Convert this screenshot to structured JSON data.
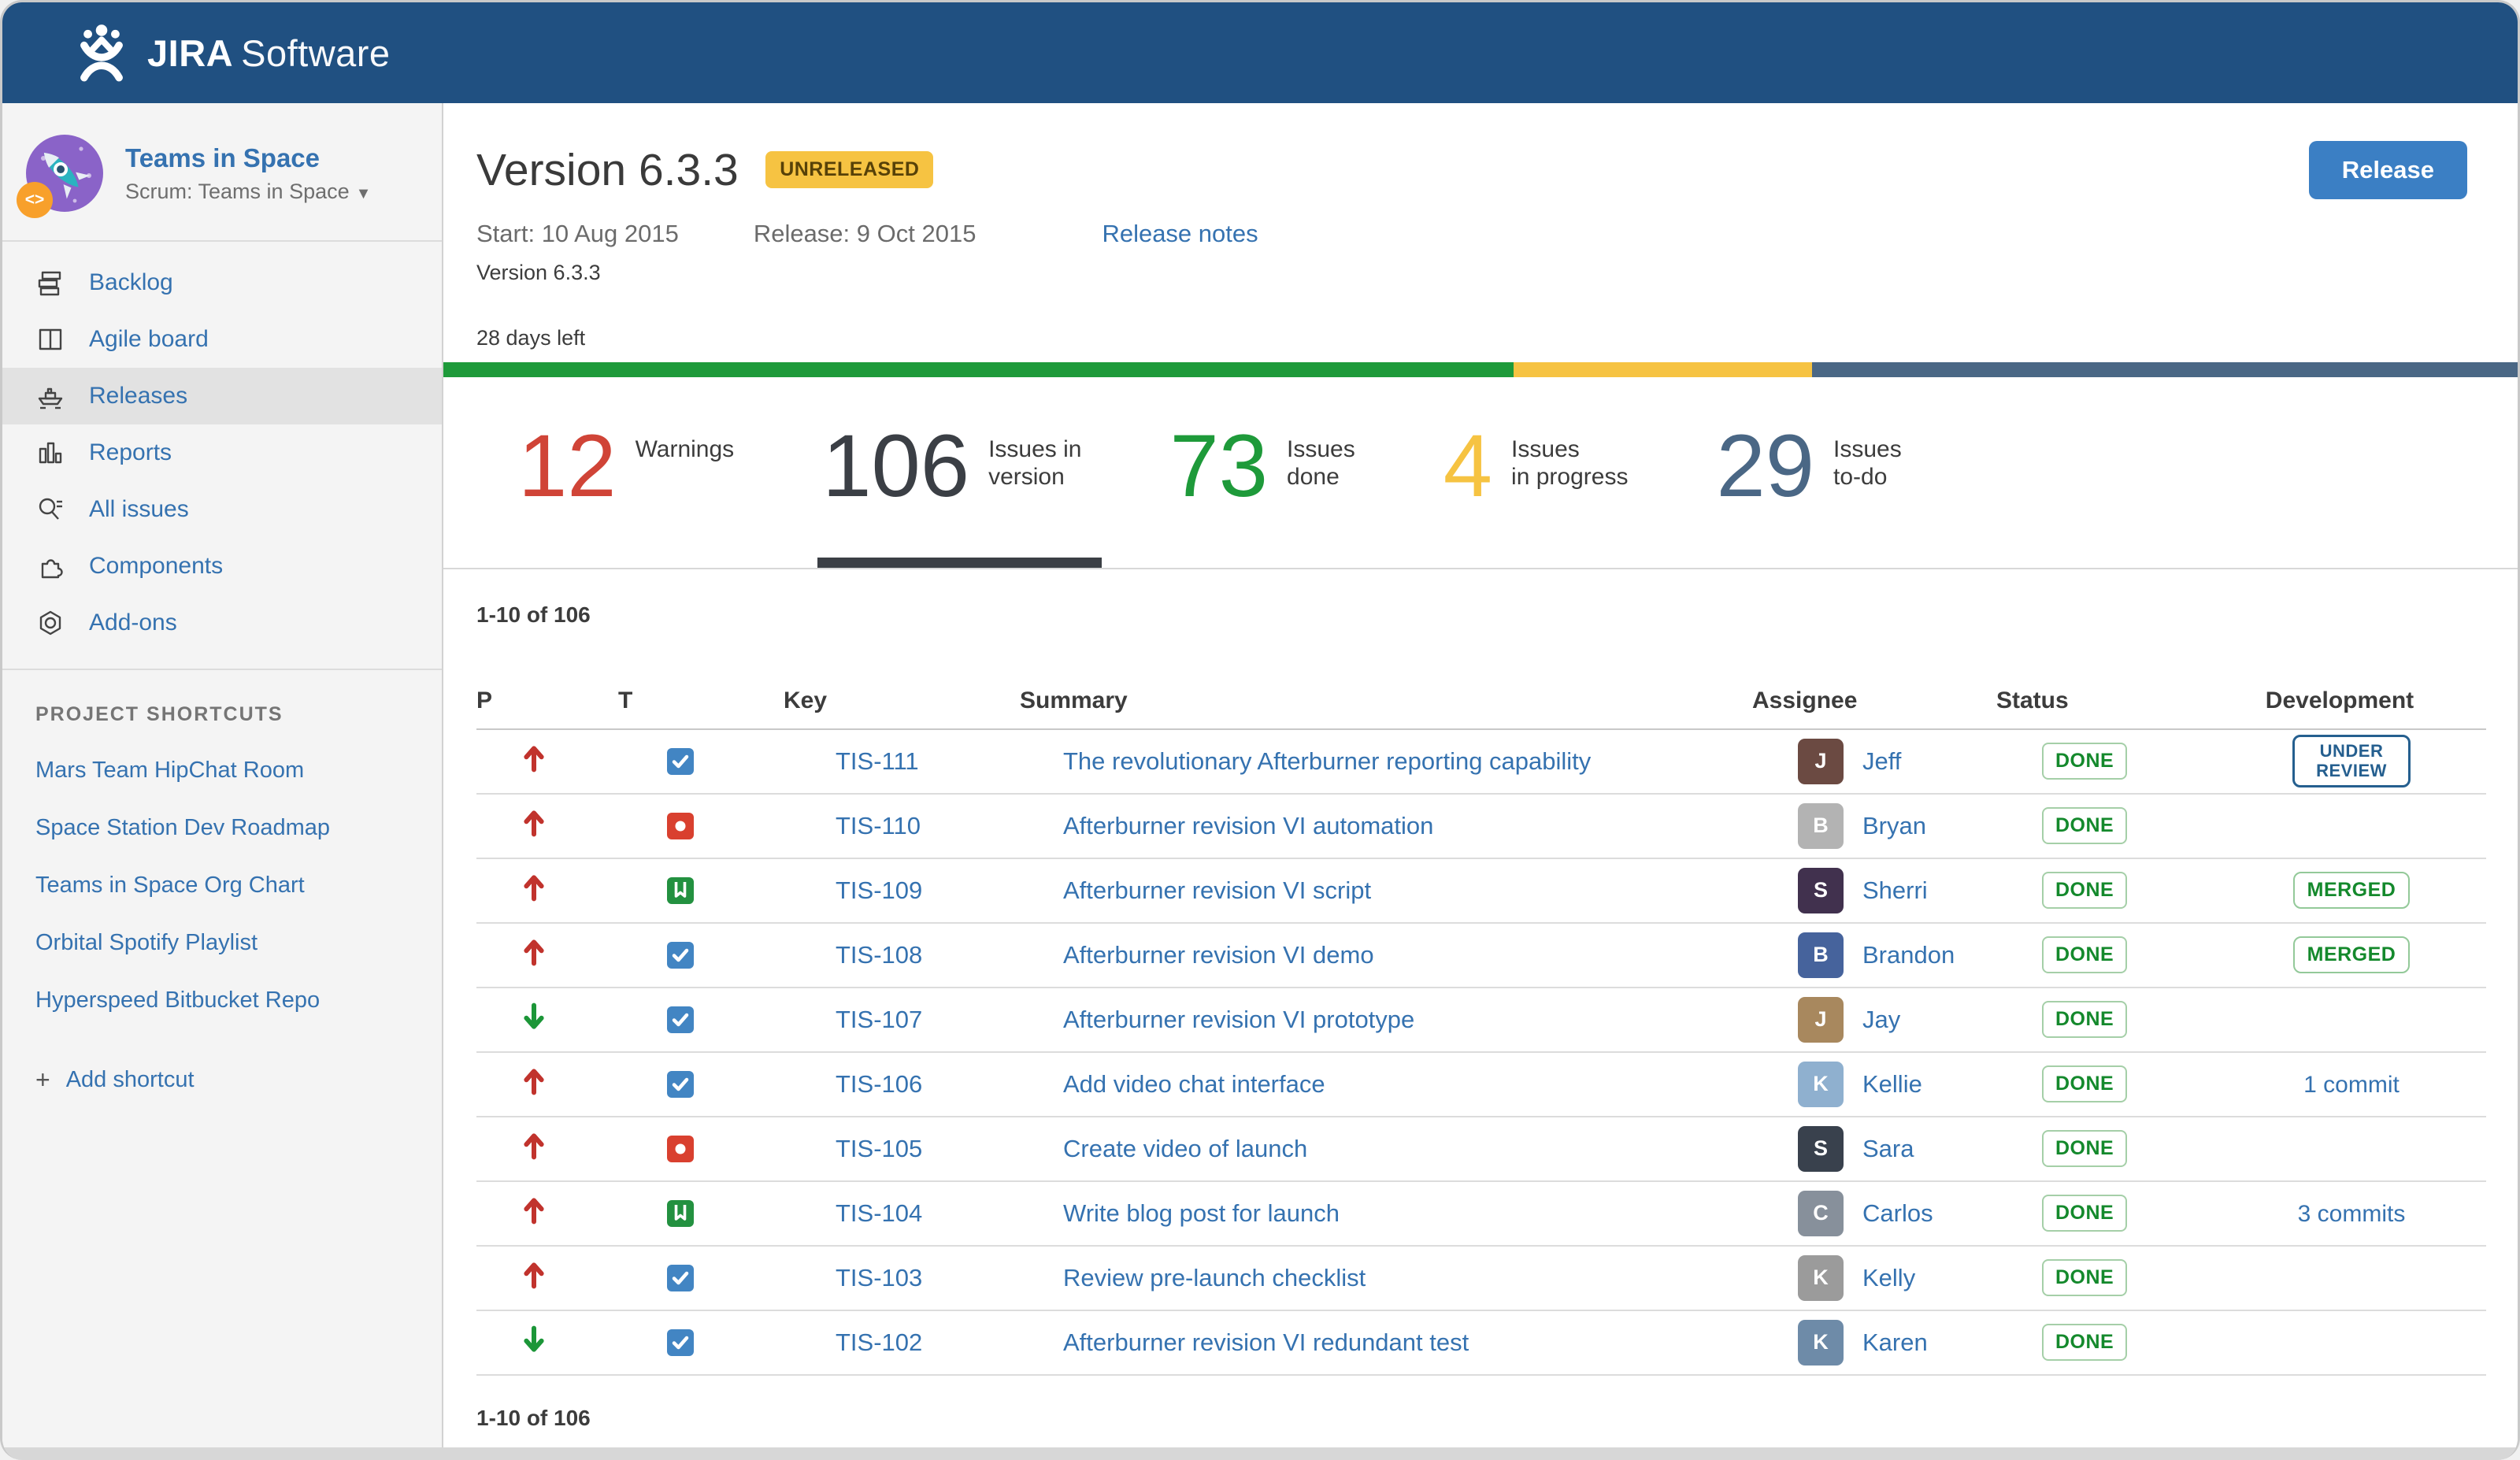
{
  "colors": {
    "header_bg": "#205081",
    "link_blue": "#3572b0",
    "green": "#1e9a3a",
    "yellow": "#f6c342",
    "slate": "#4a6785",
    "red": "#d04437",
    "dark": "#3b3f45"
  },
  "app_header": {
    "brand": "JIRA",
    "product": "Software"
  },
  "sidebar": {
    "project_name": "Teams in Space",
    "project_board": "Scrum: Teams in Space",
    "avatar_code_badge": "<>",
    "nav": [
      {
        "label": "Backlog",
        "icon": "backlog-icon",
        "active": false
      },
      {
        "label": "Agile board",
        "icon": "agile-board-icon",
        "active": false
      },
      {
        "label": "Releases",
        "icon": "releases-ship-icon",
        "active": true
      },
      {
        "label": "Reports",
        "icon": "reports-icon",
        "active": false
      },
      {
        "label": "All issues",
        "icon": "all-issues-icon",
        "active": false
      },
      {
        "label": "Components",
        "icon": "components-icon",
        "active": false
      },
      {
        "label": "Add-ons",
        "icon": "add-ons-icon",
        "active": false
      }
    ],
    "shortcuts_title": "PROJECT SHORTCUTS",
    "shortcuts": [
      "Mars Team HipChat Room",
      "Space Station Dev Roadmap",
      "Teams in Space Org Chart",
      "Orbital Spotify Playlist",
      "Hyperspeed Bitbucket Repo"
    ],
    "add_shortcut_plus": "+",
    "add_shortcut_label": "Add shortcut"
  },
  "release": {
    "title": "Version 6.3.3",
    "status_badge": "UNRELEASED",
    "start": "Start: 10 Aug 2015",
    "release_date": "Release: 9 Oct 2015",
    "release_notes_link": "Release notes",
    "subtitle": "Version 6.3.3",
    "days_left": "28 days left",
    "release_button": "Release",
    "progress_segments": [
      {
        "name": "done",
        "color": "#1e9a3a",
        "pct": 51.6
      },
      {
        "name": "in-progress",
        "color": "#f6c342",
        "pct": 14.4
      },
      {
        "name": "to-do",
        "color": "#4a6785",
        "pct": 34.0
      }
    ]
  },
  "stats": [
    {
      "value": "12",
      "label": "Warnings",
      "color": "#d04437",
      "active": false
    },
    {
      "value": "106",
      "label": "Issues in\nversion",
      "color": "#3b3f45",
      "active": true
    },
    {
      "value": "73",
      "label": "Issues\ndone",
      "color": "#1e9a3a",
      "active": false
    },
    {
      "value": "4",
      "label": "Issues\nin progress",
      "color": "#f6c342",
      "active": false
    },
    {
      "value": "29",
      "label": "Issues\nto-do",
      "color": "#4a6785",
      "active": false
    }
  ],
  "table": {
    "count_top": "1-10 of 106",
    "count_bottom": "1-10 of 106",
    "columns": [
      "P",
      "T",
      "Key",
      "Summary",
      "Assignee",
      "Status",
      "Development"
    ],
    "rows": [
      {
        "priority": "up",
        "type": "task",
        "key": "TIS-111",
        "summary": "The revolutionary Afterburner reporting capability",
        "assignee": "Jeff",
        "avatar_color": "#6b4a42",
        "status": "DONE",
        "dev_badge": "UNDER REVIEW",
        "dev_link": ""
      },
      {
        "priority": "up",
        "type": "bug",
        "key": "TIS-110",
        "summary": "Afterburner revision VI automation",
        "assignee": "Bryan",
        "avatar_color": "#b3b3b3",
        "status": "DONE",
        "dev_badge": "",
        "dev_link": ""
      },
      {
        "priority": "up",
        "type": "story",
        "key": "TIS-109",
        "summary": "Afterburner revision VI script",
        "assignee": "Sherri",
        "avatar_color": "#41314e",
        "status": "DONE",
        "dev_badge": "MERGED",
        "dev_link": ""
      },
      {
        "priority": "up",
        "type": "task",
        "key": "TIS-108",
        "summary": "Afterburner revision VI demo",
        "assignee": "Brandon",
        "avatar_color": "#46639c",
        "status": "DONE",
        "dev_badge": "MERGED",
        "dev_link": ""
      },
      {
        "priority": "down",
        "type": "task",
        "key": "TIS-107",
        "summary": "Afterburner revision VI prototype",
        "assignee": "Jay",
        "avatar_color": "#a8885e",
        "status": "DONE",
        "dev_badge": "",
        "dev_link": ""
      },
      {
        "priority": "up",
        "type": "task",
        "key": "TIS-106",
        "summary": "Add video chat interface",
        "assignee": "Kellie",
        "avatar_color": "#8fb0cf",
        "status": "DONE",
        "dev_badge": "",
        "dev_link": "1 commit"
      },
      {
        "priority": "up",
        "type": "bug",
        "key": "TIS-105",
        "summary": "Create video of launch",
        "assignee": "Sara",
        "avatar_color": "#39414d",
        "status": "DONE",
        "dev_badge": "",
        "dev_link": ""
      },
      {
        "priority": "up",
        "type": "story",
        "key": "TIS-104",
        "summary": "Write blog post for launch",
        "assignee": "Carlos",
        "avatar_color": "#87909b",
        "status": "DONE",
        "dev_badge": "",
        "dev_link": "3 commits"
      },
      {
        "priority": "up",
        "type": "task",
        "key": "TIS-103",
        "summary": "Review pre-launch checklist",
        "assignee": "Kelly",
        "avatar_color": "#9b9b9b",
        "status": "DONE",
        "dev_badge": "",
        "dev_link": ""
      },
      {
        "priority": "down",
        "type": "task",
        "key": "TIS-102",
        "summary": "Afterburner revision VI redundant test",
        "assignee": "Karen",
        "avatar_color": "#6e8ba8",
        "status": "DONE",
        "dev_badge": "",
        "dev_link": ""
      }
    ]
  }
}
